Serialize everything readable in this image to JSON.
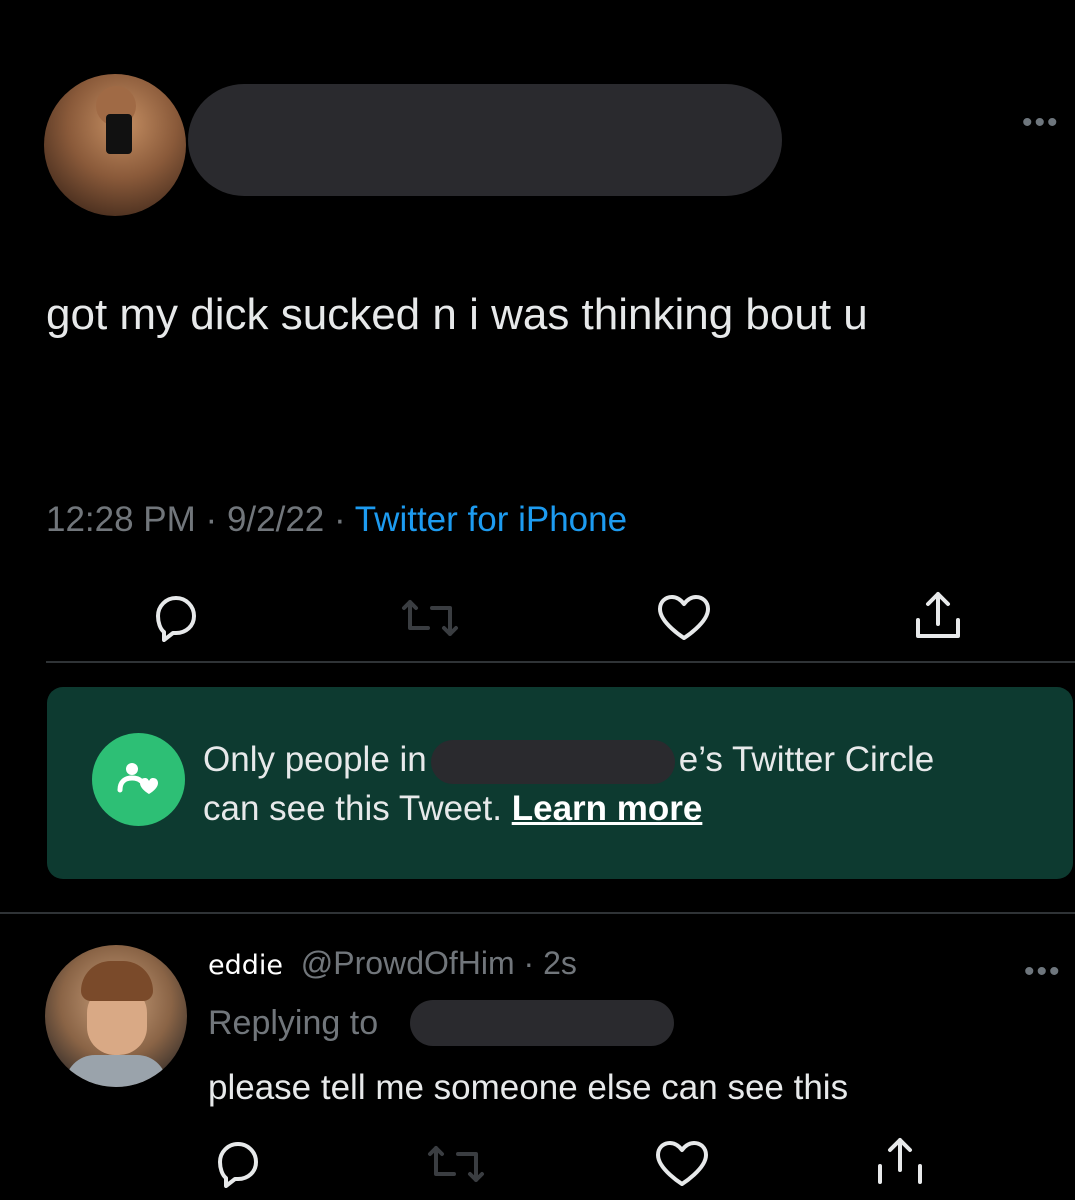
{
  "tweet": {
    "text": "got my dick sucked n i was thinking bout u",
    "time": "12:28 PM",
    "date": "9/2/22",
    "separator": "·",
    "source": "Twitter for iPhone",
    "more_icon": "more-horizontal-icon"
  },
  "circle_notice": {
    "text_before": "Only people in",
    "text_after": "e’s Twitter Circle",
    "text_line2": "can see this Tweet.",
    "learn_more": "Learn more",
    "icon": "twitter-circle-icon",
    "accent": "#2dbf75"
  },
  "reply": {
    "name": "eddie",
    "handle": "@ProwdOfHim",
    "age": "2s",
    "separator": "·",
    "replying_to": "Replying to",
    "text": "please tell me someone else can see this"
  },
  "colors": {
    "background": "#000000",
    "text": "#e7e9ea",
    "muted": "#71767b",
    "link": "#1d9bf0",
    "circle_bg": "#0d3a30"
  }
}
